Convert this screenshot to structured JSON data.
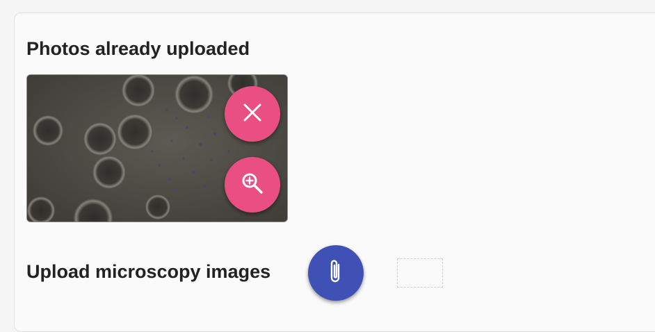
{
  "uploaded_section": {
    "title": "Photos already uploaded",
    "photo": {
      "description_icon": "microscopy-image",
      "actions": [
        {
          "name": "delete",
          "icon": "close-icon",
          "color": "#ea4f84"
        },
        {
          "name": "zoom",
          "icon": "zoom-in-icon",
          "color": "#ea4f84"
        }
      ]
    }
  },
  "upload_section": {
    "title": "Upload microscopy images",
    "attach_icon": "paperclip-icon",
    "attach_color": "#3f51b5"
  },
  "colors": {
    "accent_pink": "#ea4f84",
    "accent_indigo": "#3f51b5",
    "text": "#222222",
    "background": "#fafafa"
  }
}
